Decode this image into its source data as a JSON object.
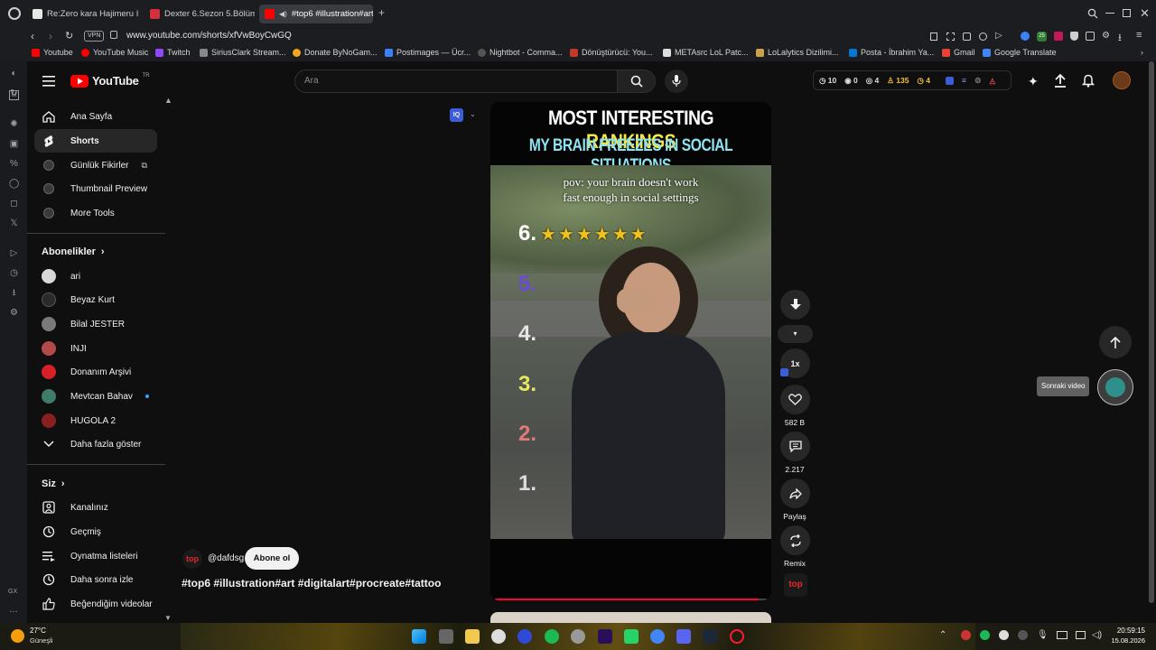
{
  "browser": {
    "tabs": [
      {
        "title": "Re:Zero kara Hajimeru Isek",
        "icon": "anime-site-icon"
      },
      {
        "title": "Dexter 6.Sezon 5.Bölüm Tü",
        "icon": "red-site-icon"
      },
      {
        "title": "#top6 #illustration#art",
        "icon": "youtube-icon"
      }
    ],
    "vpn_badge": "VPN",
    "url": "www.youtube.com/shorts/xfVwBoyCwGQ",
    "bookmarks": [
      {
        "label": "Youtube",
        "color": "#ff0000"
      },
      {
        "label": "YouTube Music",
        "color": "#ff0000"
      },
      {
        "label": "Twitch",
        "color": "#9146ff"
      },
      {
        "label": "SiriusClark Stream...",
        "color": "#888888"
      },
      {
        "label": "Donate ByNoGam...",
        "color": "#f5a623"
      },
      {
        "label": "Postimages — Ücr...",
        "color": "#3b82f6"
      },
      {
        "label": "Nightbot - Comma...",
        "color": "#555555"
      },
      {
        "label": "Dönüştürücü: You...",
        "color": "#c0392b"
      },
      {
        "label": "METAsrc LoL Patc...",
        "color": "#dddddd"
      },
      {
        "label": "LoLalytics Dizilimi...",
        "color": "#caa24a"
      },
      {
        "label": "Posta - İbrahim Ya...",
        "color": "#0078d4"
      },
      {
        "label": "Gmail",
        "color": "#ea4335"
      },
      {
        "label": "Google Translate",
        "color": "#4285f4"
      }
    ],
    "ext_badge": "25"
  },
  "youtube": {
    "logo_text": "YouTube",
    "logo_region": "TR",
    "search_placeholder": "Ara",
    "stats": {
      "s1": "10",
      "s2": "0",
      "s3": "4",
      "s4": "135",
      "s5": "4"
    },
    "sidebar": {
      "main": [
        {
          "label": "Ana Sayfa",
          "icon": "home-icon"
        },
        {
          "label": "Shorts",
          "icon": "shorts-icon"
        },
        {
          "label": "Günlük Fikirler",
          "icon": "tool-icon"
        },
        {
          "label": "Thumbnail Preview",
          "icon": "tool-icon"
        },
        {
          "label": "More Tools",
          "icon": "tool-icon"
        }
      ],
      "subs_title": "Abonelikler",
      "subs": [
        {
          "label": "ari",
          "color": "#d8d8d8"
        },
        {
          "label": "Beyaz Kurt",
          "color": "#2a2a2a"
        },
        {
          "label": "Bilal JESTER",
          "color": "#7a7a7a"
        },
        {
          "label": "INJI",
          "color": "#b34a4a"
        },
        {
          "label": "Donanım Arşivi",
          "color": "#d61f26"
        },
        {
          "label": "Mevtcan Bahav",
          "color": "#3f7b6a"
        },
        {
          "label": "HUGOLA 2",
          "color": "#8a1f1f"
        }
      ],
      "show_more": "Daha fazla göster",
      "you_title": "Siz",
      "you": [
        {
          "label": "Kanalınız",
          "icon": "channel-icon"
        },
        {
          "label": "Geçmiş",
          "icon": "history-icon"
        },
        {
          "label": "Oynatma listeleri",
          "icon": "playlist-icon"
        },
        {
          "label": "Daha sonra izle",
          "icon": "clock-icon"
        },
        {
          "label": "Beğendiğim videolar",
          "icon": "like-icon"
        }
      ]
    },
    "short": {
      "title_a": "MOST INTERESTING",
      "title_b": "RANKINGS",
      "subtitle": "MY BRAIN FREEZES IN SOCIAL SITUATIONS",
      "caption_1": "pov: your brain doesn't work",
      "caption_2": "fast enough in social settings",
      "ranks": [
        "6.",
        "5.",
        "4.",
        "3.",
        "2.",
        "1."
      ],
      "rank_colors": [
        "#ffffff",
        "#6a4bd8",
        "#ffffff",
        "#e6e85a",
        "#e07a7a",
        "#ffffff"
      ],
      "stars": "★★★★★★",
      "channel_badge": "top",
      "channel_handle": "@dafdsg",
      "subscribe": "Abone ol",
      "description": "#top6 #illustration#art #digitalart#procreate#tattoo",
      "progress": 0.97
    },
    "actions": {
      "speed": "1x",
      "likes": "582 B",
      "comments": "2.217",
      "share": "Paylaş",
      "remix": "Remix",
      "next_tooltip": "Sonraki video"
    }
  },
  "taskbar": {
    "weather_temp": "27°C",
    "weather_label": "Güneşli",
    "time": "20:59:15",
    "date": "15.08.2026",
    "side_label": "GX"
  }
}
